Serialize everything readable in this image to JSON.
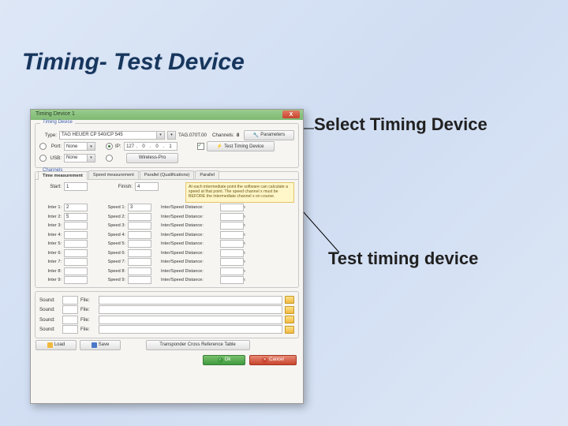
{
  "slide": {
    "title": "Timing- Test Device",
    "annot_select": "Select Timing Device",
    "annot_test": "Test timing device"
  },
  "dialog": {
    "title": "Timing Device 1",
    "close_x": "X",
    "timing_group": "Timing Device",
    "type_lbl": "Type:",
    "type_val": "TAG HEUER CP 540/CP 545",
    "tagfile": "TAG.070T.00",
    "channels_lbl": "Channels:",
    "channels_val": "8",
    "parameters_btn": "Parameters",
    "port_lbl": "Port:",
    "port_val": "None",
    "ip_lbl": "IP:",
    "ip": [
      "127",
      "0",
      "0",
      "1"
    ],
    "test_btn": "Test Timing Device",
    "usb_lbl": "USB:",
    "usb_val": "None",
    "wireless_btn": "Wireless-Pro",
    "channels_group": "Channels",
    "tabs": [
      "Time measurement",
      "Speed measurement",
      "Parallel (Qualifications)",
      "Parallel"
    ],
    "start_lbl": "Start:",
    "start_val": "1",
    "finish_lbl": "Finish:",
    "finish_val": "4",
    "hint": "At each intermediate point the software can calculate a speed at that point. The speed channel x must be BEFORE the intermediate channel x on course.",
    "inter_pref": "Inter ",
    "speed_pref": "Speed ",
    "dist_lbl": "Inter/Speed Distance:",
    "m_lbl": "m",
    "rows": [
      {
        "i": "1",
        "iv": "2",
        "sv": "3"
      },
      {
        "i": "2",
        "iv": "5",
        "sv": ""
      },
      {
        "i": "3",
        "iv": "",
        "sv": ""
      },
      {
        "i": "4",
        "iv": "",
        "sv": ""
      },
      {
        "i": "5",
        "iv": "",
        "sv": ""
      },
      {
        "i": "6",
        "iv": "",
        "sv": ""
      },
      {
        "i": "7",
        "iv": "",
        "sv": ""
      },
      {
        "i": "8",
        "iv": "",
        "sv": ""
      },
      {
        "i": "9",
        "iv": "",
        "sv": ""
      }
    ],
    "sound_lbl": "Sound:",
    "file_lbl": "File:",
    "load_btn": "Load",
    "save_btn": "Save",
    "xref_btn": "Transponder Cross Reference Table",
    "ok_btn": "Ok",
    "cancel_btn": "Cancel"
  }
}
